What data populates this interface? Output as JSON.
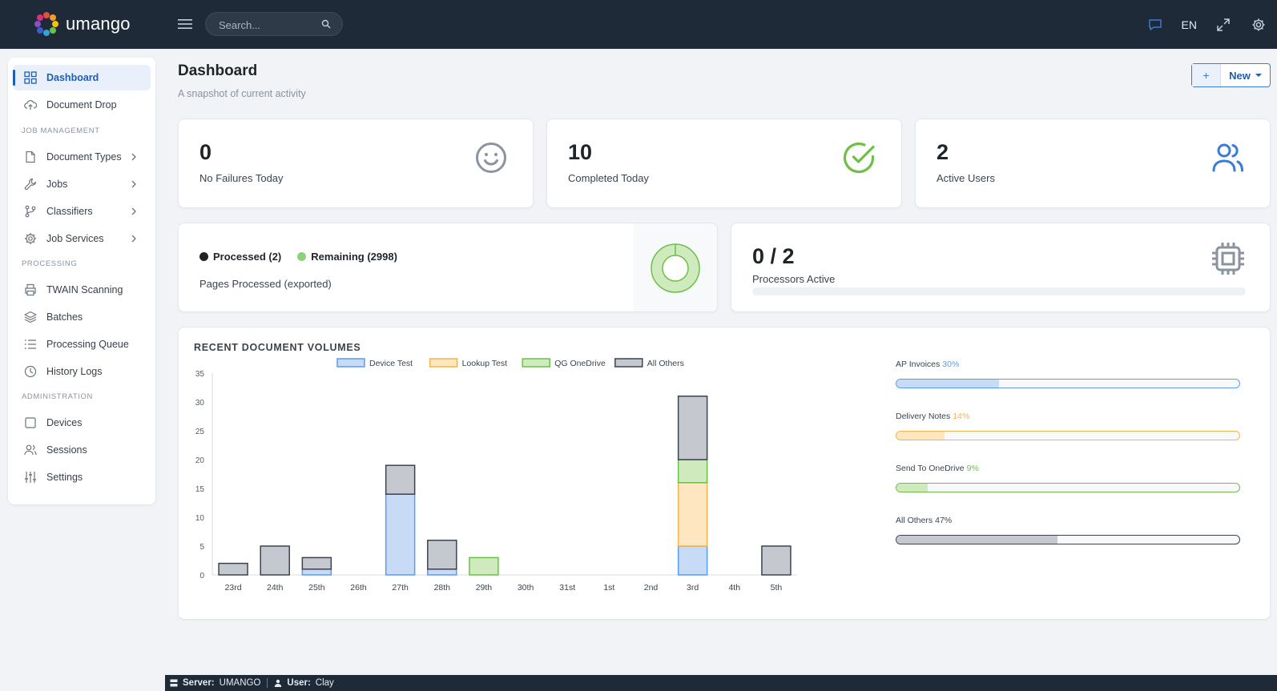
{
  "app": {
    "name": "umango"
  },
  "topbar": {
    "search_placeholder": "Search...",
    "language": "EN",
    "icons": [
      "menu-icon",
      "search-icon",
      "chat-icon",
      "expand-icon",
      "gear-icon"
    ]
  },
  "sidebar": {
    "items": [
      {
        "label": "Dashboard",
        "icon": "dashboard-grid-icon",
        "active": true
      },
      {
        "label": "Document Drop",
        "icon": "cloud-upload-icon"
      },
      {
        "label": "Document Types",
        "icon": "document-icon",
        "chevron": true
      },
      {
        "label": "Jobs",
        "icon": "wrench-icon",
        "chevron": true
      },
      {
        "label": "Classifiers",
        "icon": "branch-icon",
        "chevron": true
      },
      {
        "label": "Job Services",
        "icon": "gear-icon",
        "chevron": true
      },
      {
        "label": "TWAIN Scanning",
        "icon": "printer-icon"
      },
      {
        "label": "Batches",
        "icon": "layers-icon"
      },
      {
        "label": "Processing Queue",
        "icon": "list-icon"
      },
      {
        "label": "History Logs",
        "icon": "clock-icon"
      },
      {
        "label": "Devices",
        "icon": "square-icon"
      },
      {
        "label": "Sessions",
        "icon": "users-icon"
      },
      {
        "label": "Settings",
        "icon": "sliders-icon"
      }
    ],
    "sections": [
      "JOB MANAGEMENT",
      "PROCESSING",
      "ADMINISTRATION"
    ]
  },
  "header": {
    "title": "Dashboard",
    "subtitle": "A snapshot of current activity",
    "new_button": "New",
    "plus": "+"
  },
  "stats": [
    {
      "value": "0",
      "label": "No Failures Today",
      "icon": "smiley-icon",
      "color": "#8a939e"
    },
    {
      "value": "10",
      "label": "Completed Today",
      "icon": "check-circle-icon",
      "color": "#6cc04a"
    },
    {
      "value": "2",
      "label": "Active Users",
      "icon": "users-icon",
      "color": "#3a7bd5"
    }
  ],
  "pages": {
    "processed_label": "Processed (2)",
    "remaining_label": "Remaining (2998)",
    "label": "Pages Processed (exported)",
    "processed": 2,
    "remaining": 2998,
    "processed_color": "#1f2429",
    "remaining_color": "#8fd17a"
  },
  "processors": {
    "value": "0 / 2",
    "label": "Processors Active",
    "active": 0,
    "total": 2,
    "icon": "cpu-icon"
  },
  "volumes": {
    "title": "RECENT DOCUMENT VOLUMES",
    "progress": [
      {
        "name": "AP Invoices",
        "pct_label": "30%",
        "pct": 30,
        "color": "#5b9bf0",
        "fill": "#c7dbf7"
      },
      {
        "name": "Delivery Notes",
        "pct_label": "14%",
        "pct": 14,
        "color": "#f3b44a",
        "fill": "#fde6c0"
      },
      {
        "name": "Send To OneDrive",
        "pct_label": "9%",
        "pct": 9,
        "color": "#6cc04a",
        "fill": "#cfeabd"
      },
      {
        "name": "All Others",
        "pct_label": "47%",
        "pct": 47,
        "color": "#3b444e",
        "fill": "#c5c9cf"
      }
    ]
  },
  "chart_data": {
    "type": "bar",
    "stacked": true,
    "categories": [
      "23rd",
      "24th",
      "25th",
      "26th",
      "27th",
      "28th",
      "29th",
      "30th",
      "31st",
      "1st",
      "2nd",
      "3rd",
      "4th",
      "5th"
    ],
    "series": [
      {
        "name": "Device Test",
        "color": "#5b9bf0",
        "fill": "#c7dbf7",
        "values": [
          0,
          0,
          1,
          0,
          14,
          1,
          0,
          0,
          0,
          0,
          0,
          5,
          0,
          0
        ]
      },
      {
        "name": "Lookup Test",
        "color": "#f3b44a",
        "fill": "#fde6c0",
        "values": [
          0,
          0,
          0,
          0,
          0,
          0,
          0,
          0,
          0,
          0,
          0,
          11,
          0,
          0
        ]
      },
      {
        "name": "QG OneDrive",
        "color": "#6cc04a",
        "fill": "#cfeabd",
        "values": [
          0,
          0,
          0,
          0,
          0,
          0,
          3,
          0,
          0,
          0,
          0,
          4,
          0,
          0
        ]
      },
      {
        "name": "All Others",
        "color": "#3b444e",
        "fill": "#c5c9cf",
        "values": [
          2,
          5,
          2,
          0,
          5,
          5,
          0,
          0,
          0,
          0,
          0,
          11,
          0,
          5
        ]
      }
    ],
    "ylim": [
      0,
      35
    ],
    "yticks": [
      0,
      5,
      10,
      15,
      20,
      25,
      30,
      35
    ],
    "legend": "top",
    "grid": false
  },
  "footer": {
    "server_label": "Server:",
    "server": "UMANGO",
    "user_label": "User:",
    "user": "Clay"
  }
}
